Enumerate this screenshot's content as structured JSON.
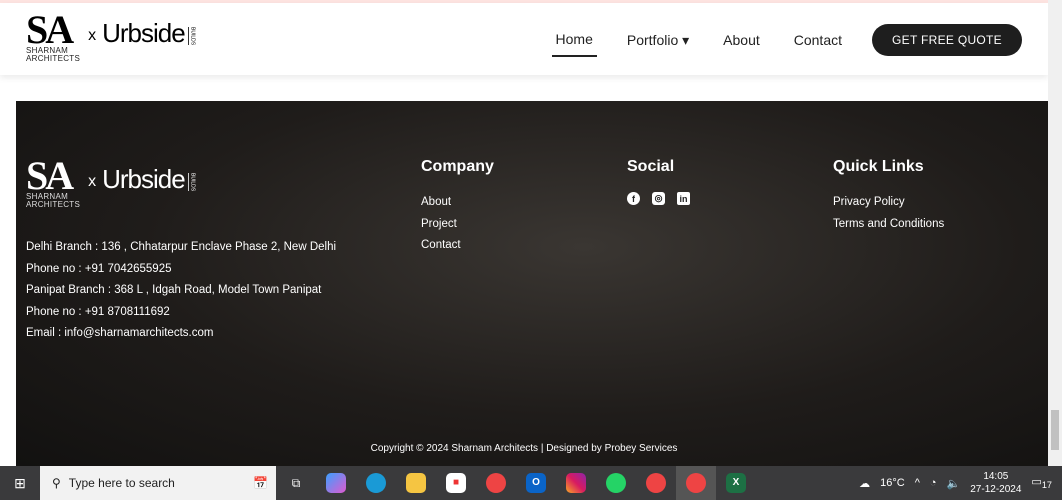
{
  "header": {
    "logo_sa": "SA",
    "logo_sub1": "SHARNAM",
    "logo_sub2": "ARCHITECTS",
    "logo_x": "x",
    "logo_urbside": "Urbside",
    "logo_builds": "BUILDS",
    "nav": [
      {
        "label": "Home"
      },
      {
        "label": "Portfolio",
        "caret": "▾"
      },
      {
        "label": "About"
      },
      {
        "label": "Contact"
      }
    ],
    "cta": "GET FREE QUOTE"
  },
  "footer": {
    "address_lines": [
      "Delhi Branch : 136 , Chhatarpur Enclave Phase 2, New Delhi",
      "Phone no : +91 7042655925",
      "Panipat Branch : 368 L , Idgah Road, Model Town Panipat",
      "Phone no : +91 8708111692",
      "Email : info@sharnamarchitects.com"
    ],
    "company": {
      "title": "Company",
      "links": [
        "About",
        "Project",
        "Contact"
      ]
    },
    "social": {
      "title": "Social",
      "icons": [
        "facebook-icon",
        "instagram-icon",
        "linkedin-icon"
      ]
    },
    "quick": {
      "title": "Quick Links",
      "links": [
        "Privacy Policy",
        "Terms and Conditions"
      ]
    },
    "copyright": "Copyright © 2024 Sharnam Architects | Designed by Probey Services"
  },
  "taskbar": {
    "search_placeholder": "Type here to search",
    "weather": "16°C",
    "time": "14:05",
    "date": "27-12-2024",
    "notifications": "17"
  }
}
